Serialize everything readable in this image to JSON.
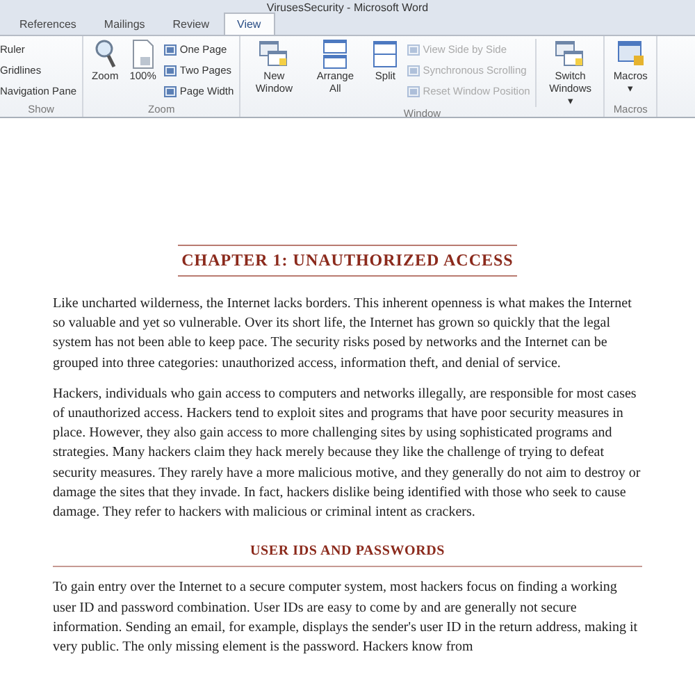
{
  "window": {
    "title": "VirusesSecurity - Microsoft Word"
  },
  "tabs": [
    {
      "label": "References",
      "selected": false
    },
    {
      "label": "Mailings",
      "selected": false
    },
    {
      "label": "Review",
      "selected": false
    },
    {
      "label": "View",
      "selected": true
    }
  ],
  "ribbon": {
    "groups": [
      {
        "name": "Show",
        "kind": "checks",
        "items": [
          {
            "label": "Ruler"
          },
          {
            "label": "Gridlines"
          },
          {
            "label": "Navigation Pane"
          }
        ]
      },
      {
        "name": "Zoom",
        "kind": "zoom",
        "items": [
          {
            "label": "Zoom"
          },
          {
            "label": "100%"
          }
        ],
        "small": [
          {
            "label": "One Page",
            "disabled": false
          },
          {
            "label": "Two Pages",
            "disabled": false
          },
          {
            "label": "Page Width",
            "disabled": false
          }
        ]
      },
      {
        "name": "Window",
        "kind": "window",
        "items": [
          {
            "label": "New Window"
          },
          {
            "label": "Arrange All"
          },
          {
            "label": "Split"
          }
        ],
        "small": [
          {
            "label": "View Side by Side",
            "disabled": true
          },
          {
            "label": "Synchronous Scrolling",
            "disabled": true
          },
          {
            "label": "Reset Window Position",
            "disabled": true
          }
        ],
        "after": [
          {
            "label": "Switch Windows",
            "caret": "▾"
          }
        ]
      },
      {
        "name": "Macros",
        "kind": "macros",
        "items": [
          {
            "label": "Macros",
            "caret": "▾"
          }
        ]
      }
    ]
  },
  "document": {
    "chapter_title": "CHAPTER 1: UNAUTHORIZED ACCESS",
    "blocks": [
      {
        "kind": "para",
        "text": "Like uncharted wilderness, the Internet lacks borders. This inherent openness is what makes the Internet so valuable and yet so vulnerable. Over its short life, the Internet has grown so quickly that the legal system has not been able to keep pace. The security risks posed by networks and the Internet can be grouped into three categories: unauthorized access, information theft, and denial of service."
      },
      {
        "kind": "para",
        "text": "Hackers, individuals who gain access to computers and networks illegally, are responsible for most cases of unauthorized access. Hackers tend to exploit sites and programs that have poor security measures in place. However, they also gain access to more challenging sites by using sophisticated programs and strategies.  Many hackers claim they hack merely because they like the challenge of trying to defeat security measures. They rarely have a more malicious motive, and they generally do not aim to destroy or damage the sites that they invade. In fact, hackers dislike being identified with those who seek to cause damage. They refer to hackers with malicious or criminal intent as crackers."
      },
      {
        "kind": "heading",
        "text": "USER IDS AND PASSWORDS"
      },
      {
        "kind": "para",
        "text": "To gain entry over the Internet to a secure computer system, most hackers focus on finding a working user ID and password combination. User IDs are easy to come by and are generally not secure information. Sending an email, for example, displays the sender's user ID in the return address, making it very public. The only missing element is the password. Hackers know from"
      }
    ]
  }
}
